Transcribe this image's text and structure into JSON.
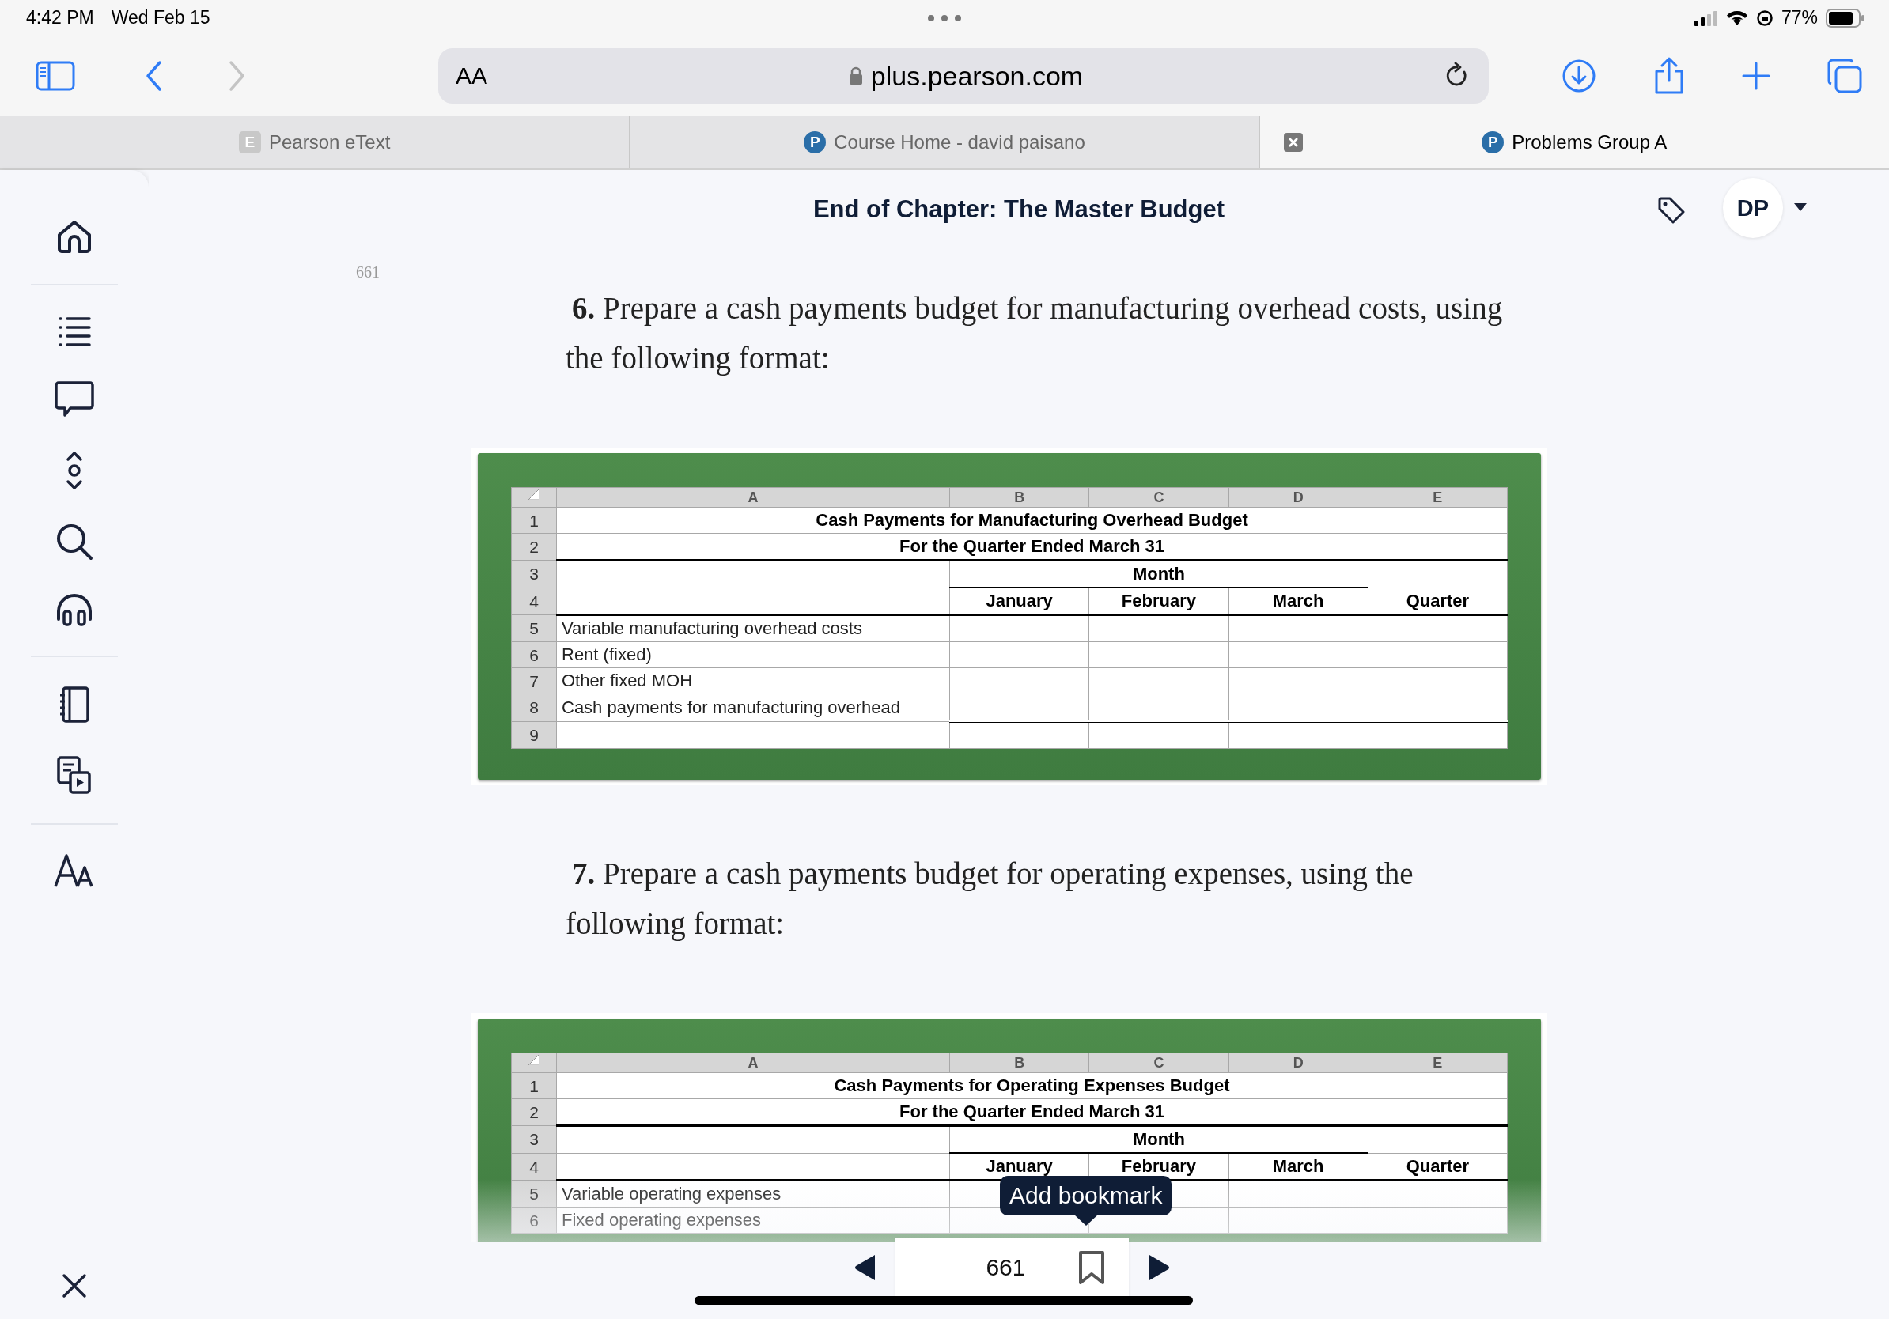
{
  "status_bar": {
    "time": "4:42 PM",
    "date": "Wed Feb 15",
    "battery": "77%"
  },
  "toolbar": {
    "forward_disabled": true,
    "text_size": "AA",
    "url": "plus.pearson.com"
  },
  "tabs": [
    {
      "label": "Pearson eText",
      "favicon": "E",
      "kind": "square",
      "selected": false
    },
    {
      "label": "Course Home - david paisano",
      "favicon": "P",
      "kind": "circle",
      "selected": false
    },
    {
      "label": "Problems Group A",
      "favicon": "P",
      "kind": "circle",
      "selected": true
    }
  ],
  "header": {
    "title": "End of Chapter: The Master Budget",
    "avatar": "DP"
  },
  "page_number": "661",
  "sections": [
    {
      "question": "**6.** Prepare a cash payments budget for manufacturing overhead costs, using the following format:",
      "table": {
        "columns": [
          "A",
          "B",
          "C",
          "D",
          "E"
        ],
        "rows": [
          {
            "number": "1",
            "kind": "title",
            "text": "Cash Payments for Manufacturing Overhead Budget"
          },
          {
            "number": "2",
            "kind": "title",
            "text": "For the Quarter Ended March 31"
          },
          {
            "number": "3",
            "kind": "group",
            "text": "Month"
          },
          {
            "number": "4",
            "kind": "heads",
            "cells": [
              "January",
              "February",
              "March",
              "Quarter"
            ]
          },
          {
            "number": "5",
            "kind": "label",
            "text": "Variable manufacturing overhead costs"
          },
          {
            "number": "6",
            "kind": "label",
            "text": "Rent (fixed)"
          },
          {
            "number": "7",
            "kind": "label",
            "text": "Other fixed MOH"
          },
          {
            "number": "8",
            "kind": "total",
            "text": "Cash payments for manufacturing overhead"
          },
          {
            "number": "9",
            "kind": "blank"
          }
        ]
      }
    },
    {
      "question": "**7.** Prepare a cash payments budget for operating expenses, using the following format:",
      "table": {
        "columns": [
          "A",
          "B",
          "C",
          "D",
          "E"
        ],
        "rows": [
          {
            "number": "1",
            "kind": "title",
            "text": "Cash Payments for Operating Expenses Budget"
          },
          {
            "number": "2",
            "kind": "title",
            "text": "For the Quarter Ended March 31"
          },
          {
            "number": "3",
            "kind": "group",
            "text": "Month"
          },
          {
            "number": "4",
            "kind": "heads",
            "cells": [
              "January",
              "February",
              "March",
              "Quarter"
            ]
          },
          {
            "number": "5",
            "kind": "label",
            "text": "Variable operating expenses"
          },
          {
            "number": "6",
            "kind": "label",
            "text": "Fixed operating expenses"
          }
        ]
      }
    }
  ],
  "pager": {
    "page": "661",
    "tooltip": "Add bookmark"
  }
}
